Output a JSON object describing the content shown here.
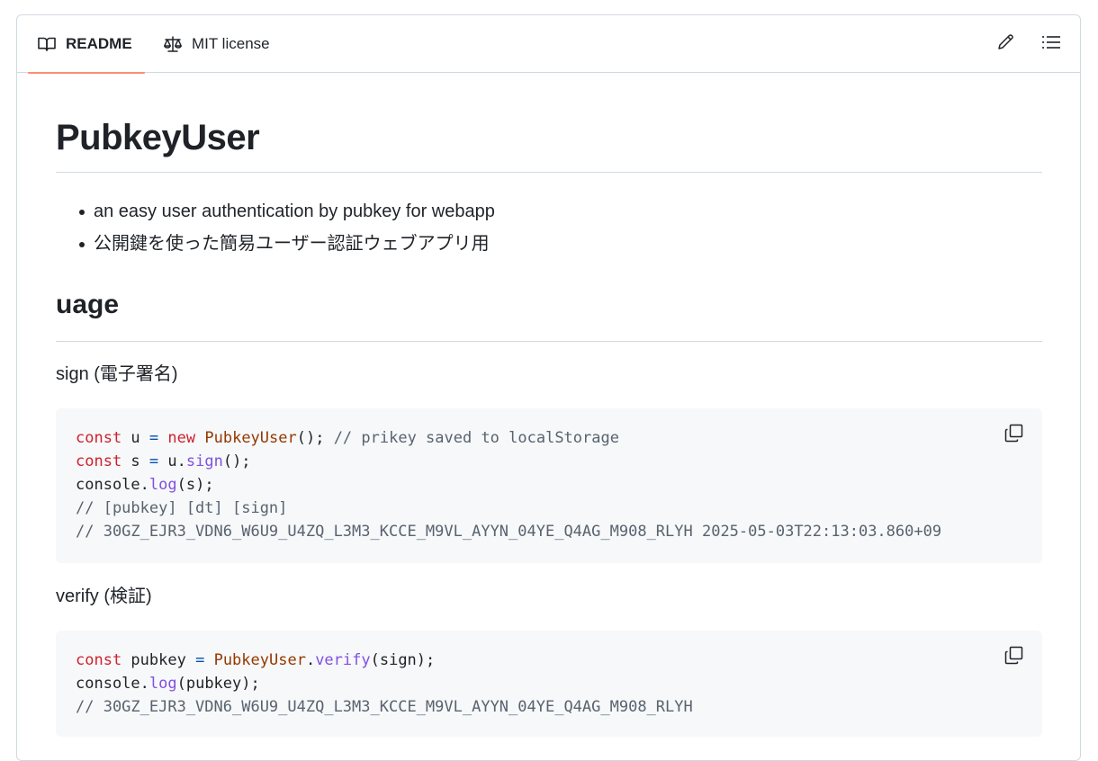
{
  "tabs": {
    "readme": "README",
    "license": "MIT license"
  },
  "readme": {
    "title": "PubkeyUser",
    "bullets": [
      "an easy user authentication by pubkey for webapp",
      "公開鍵を使った簡易ユーザー認証ウェブアプリ用"
    ],
    "section_title": "uage",
    "sign_label": "sign (電子署名)",
    "verify_label": "verify (検証)"
  },
  "code1": {
    "l1": {
      "kw1": "const",
      "t1": " u ",
      "op1": "=",
      "sp": " ",
      "kw2": "new",
      "sp2": " ",
      "cls": "PubkeyUser",
      "t2": "(); ",
      "cm": "// prikey saved to localStorage"
    },
    "l2": {
      "kw": "const",
      "t1": " s ",
      "op": "=",
      "t2": " u.",
      "fn": "sign",
      "t3": "();"
    },
    "l3": {
      "t1": "console.",
      "fn": "log",
      "t2": "(s);"
    },
    "l4": "// [pubkey] [dt] [sign]",
    "l5": "// 30GZ_EJR3_VDN6_W6U9_U4ZQ_L3M3_KCCE_M9VL_AYYN_04YE_Q4AG_M908_RLYH 2025-05-03T22:13:03.860+09"
  },
  "code2": {
    "l1": {
      "kw": "const",
      "t1": " pubkey ",
      "op": "=",
      "sp": " ",
      "cls": "PubkeyUser",
      "t2": ".",
      "fn": "verify",
      "t3": "(sign);"
    },
    "l2": {
      "t1": "console.",
      "fn": "log",
      "t2": "(pubkey);"
    },
    "l3": "// 30GZ_EJR3_VDN6_W6U9_U4ZQ_L3M3_KCCE_M9VL_AYYN_04YE_Q4AG_M908_RLYH"
  },
  "icons": {
    "readme_tab": "book-icon",
    "license_tab": "law-icon",
    "edit": "pencil-icon",
    "outline": "list-unordered-icon",
    "copy": "copy-icon"
  },
  "colors": {
    "active_tab_underline": "#fd8c73",
    "keyword": "#cf222e",
    "class": "#953800",
    "function": "#8250df",
    "operator": "#0550ae",
    "comment": "#59636e"
  }
}
